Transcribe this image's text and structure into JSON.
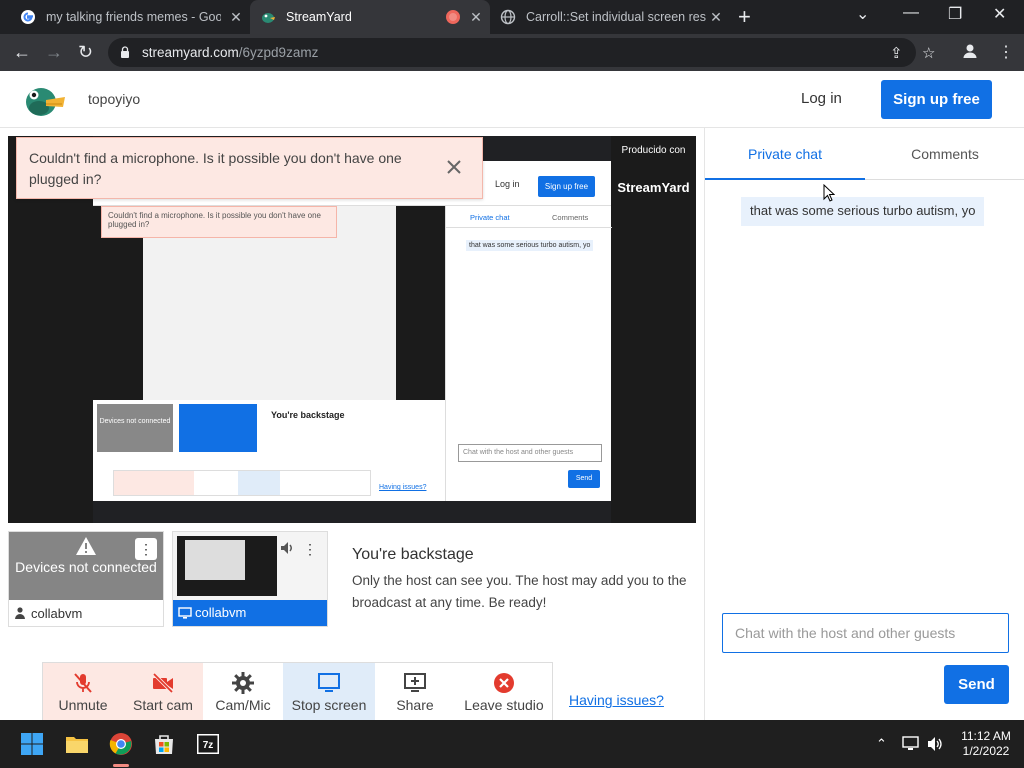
{
  "browser": {
    "tabs": [
      {
        "title": "my talking friends memes - Goog",
        "active": false
      },
      {
        "title": "StreamYard",
        "active": true
      },
      {
        "title": "Carroll::Set individual screen reso",
        "active": false
      }
    ],
    "url_domain": "streamyard.com",
    "url_path": "/6yzpd9zamz"
  },
  "header": {
    "username": "topoyiyo",
    "login_label": "Log in",
    "signup_label": "Sign up free"
  },
  "toast": {
    "message": "Couldn't find a microphone. Is it possible you don't have one plugged in?"
  },
  "stage": {
    "watermark_line1": "Producido con",
    "watermark_line2": "StreamYard"
  },
  "participants": [
    {
      "name": "collabvm",
      "status": "Devices not connected"
    },
    {
      "name": "collabvm",
      "status": ""
    }
  ],
  "backstage": {
    "title": "You're backstage",
    "description": "Only the host can see you. The host may add you to the broadcast at any time. Be ready!"
  },
  "controls": {
    "unmute": "Unmute",
    "start_cam": "Start cam",
    "cam_mic": "Cam/Mic",
    "stop_screen": "Stop screen",
    "share": "Share",
    "leave_studio": "Leave studio",
    "having_issues": "Having issues?"
  },
  "chat": {
    "tab_private": "Private chat",
    "tab_comments": "Comments",
    "messages": [
      "that was some serious turbo autism, yo"
    ],
    "input_placeholder": "Chat with the host and other guests",
    "send_label": "Send"
  },
  "taskbar": {
    "time": "11:12 AM",
    "date": "1/2/2022"
  },
  "colors": {
    "accent": "#1170e4",
    "toast_bg": "#fde8e3",
    "danger": "#e33b2e"
  }
}
